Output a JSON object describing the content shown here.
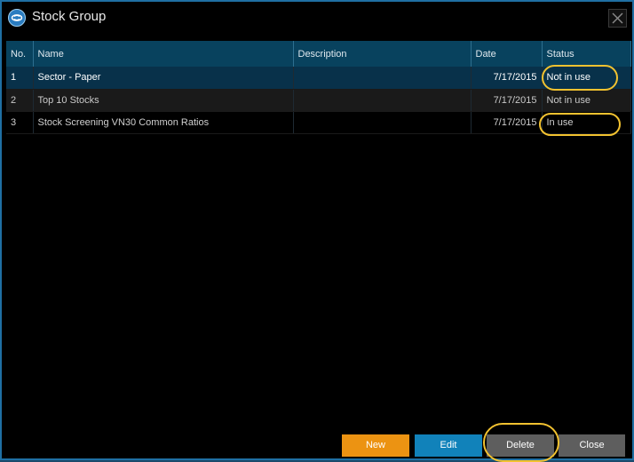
{
  "window": {
    "title": "Stock Group",
    "logo_icon": "app-logo-icon",
    "close_icon": "close-icon"
  },
  "grid": {
    "columns": [
      {
        "key": "no",
        "label": "No."
      },
      {
        "key": "name",
        "label": "Name"
      },
      {
        "key": "description",
        "label": "Description"
      },
      {
        "key": "date",
        "label": "Date"
      },
      {
        "key": "status",
        "label": "Status"
      }
    ],
    "rows": [
      {
        "no": "1",
        "name": "Sector - Paper",
        "description": "",
        "date": "7/17/2015",
        "status": "Not in use",
        "selected": true
      },
      {
        "no": "2",
        "name": "Top 10 Stocks",
        "description": "",
        "date": "7/17/2015",
        "status": "Not in use",
        "selected": false
      },
      {
        "no": "3",
        "name": "Stock Screening VN30 Common Ratios",
        "description": "",
        "date": "7/17/2015",
        "status": "In use",
        "selected": false
      }
    ]
  },
  "buttons": {
    "new_label": "New",
    "edit_label": "Edit",
    "delete_label": "Delete",
    "close_label": "Close"
  },
  "colors": {
    "accent_orange": "#ec9312",
    "accent_blue": "#1182ba",
    "header_bg": "#08425e",
    "highlight_ring": "#f2c230"
  }
}
